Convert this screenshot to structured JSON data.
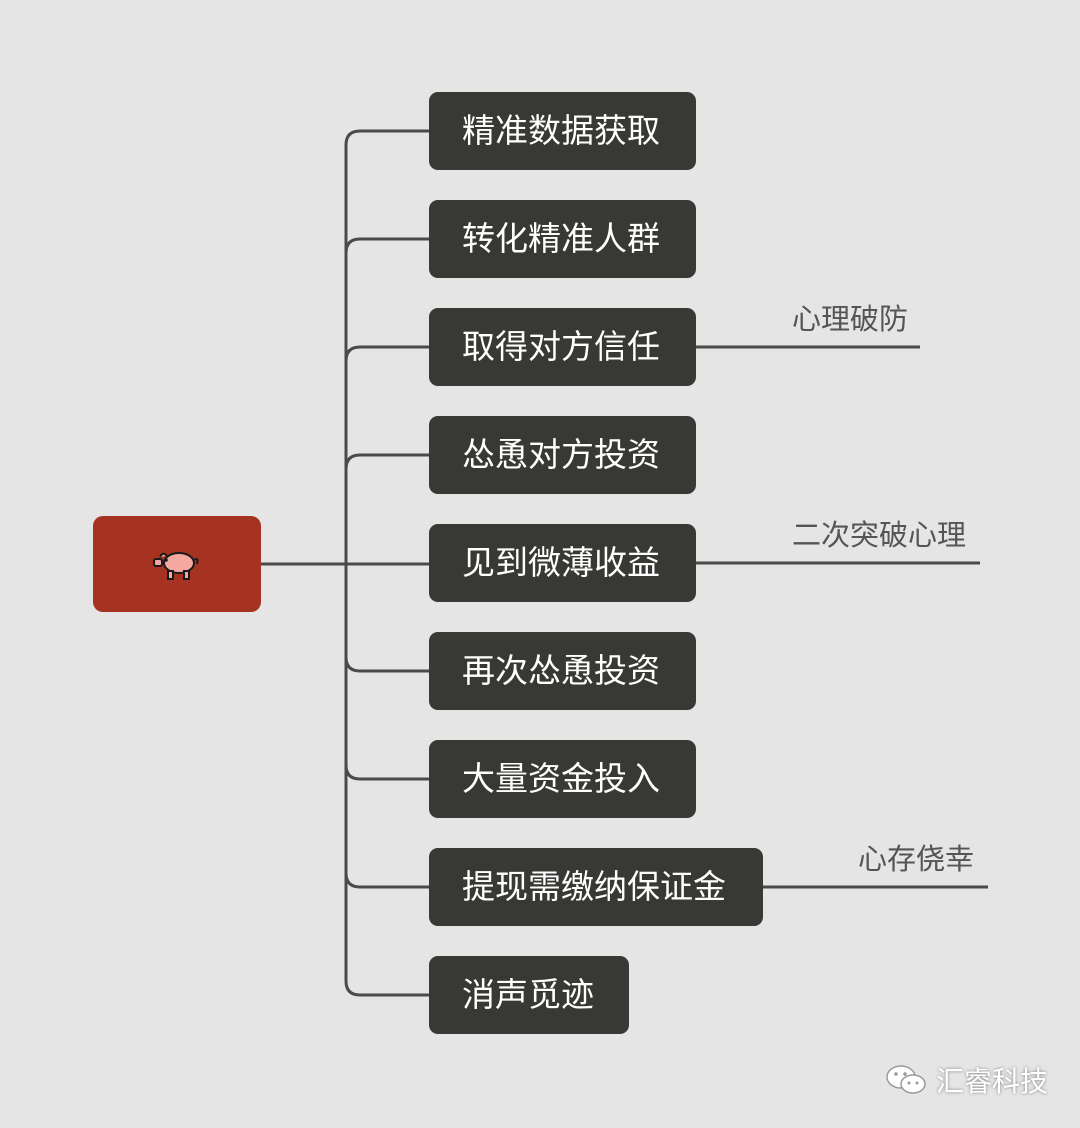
{
  "root": {
    "icon": "pig-icon"
  },
  "steps": [
    {
      "label": "精准数据获取"
    },
    {
      "label": "转化精准人群"
    },
    {
      "label": "取得对方信任",
      "note": "心理破防"
    },
    {
      "label": "怂恿对方投资"
    },
    {
      "label": "见到微薄收益",
      "note": "二次突破心理"
    },
    {
      "label": "再次怂恿投资"
    },
    {
      "label": "大量资金投入"
    },
    {
      "label": "提现需缴纳保证金",
      "note": "心存侥幸"
    },
    {
      "label": "消声觅迹"
    }
  ],
  "watermark": {
    "icon": "wechat-icon",
    "text": "汇睿科技"
  },
  "colors": {
    "background": "#e5e5e5",
    "root_fill": "#a63322",
    "step_fill": "#383834",
    "connector": "#4a4a4a",
    "note_text": "#555555"
  }
}
